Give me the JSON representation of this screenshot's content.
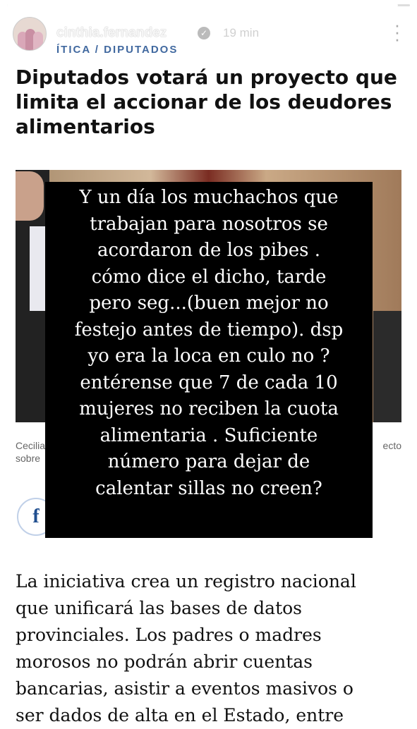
{
  "story": {
    "username": "cinthia.fernandez",
    "time": "19 min",
    "progress": 0.97
  },
  "article": {
    "section": "ÍTICA / DIPUTADOS",
    "headline": "Diputados votará un proyecto que limita el accionar de los deudores alimentarios",
    "caption_left": [
      "Cecilia",
      "sobre"
    ],
    "caption_right": "ecto",
    "body_lines": [
      "La iniciativa crea un registro nacional",
      "que unificará las bases de datos",
      "provinciales. Los padres o madres",
      "morosos no podrán abrir cuentas",
      "bancarias, asistir a eventos masivos o",
      "ser dados de alta en el Estado, entre"
    ]
  },
  "overlay": {
    "lines": [
      "Y un día los  muchachos que",
      "trabajan para nosotros se",
      "acordaron de los pibes .",
      "cómo dice el dicho, tarde",
      "pero seg...(buen mejor no",
      "festejo antes de tiempo). dsp",
      "yo era la loca en culo no ?",
      "entérense que 7 de cada 10",
      "mujeres no reciben la cuota",
      "alimentaria . Suficiente",
      "número para dejar de",
      "calentar sillas no creen?"
    ]
  },
  "icons": {
    "verified": "verified-badge-icon",
    "more": "more-vertical-icon",
    "facebook": "facebook-icon"
  }
}
